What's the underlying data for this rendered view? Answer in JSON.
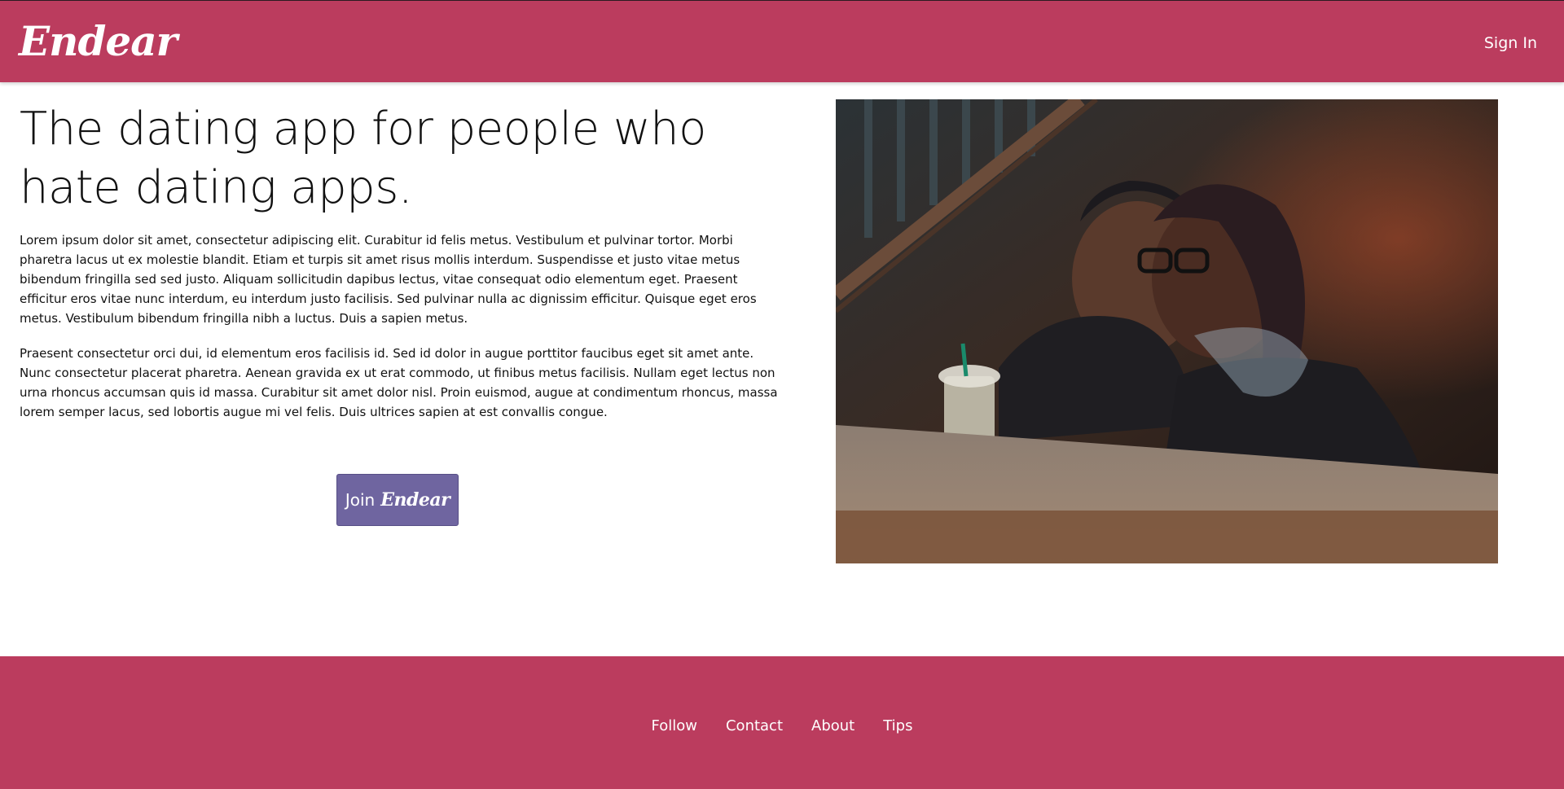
{
  "header": {
    "logo": "Endear",
    "sign_in_label": "Sign In"
  },
  "hero": {
    "headline": "The dating app for people who hate dating apps.",
    "paragraphs": [
      "Lorem ipsum dolor sit amet, consectetur adipiscing elit. Curabitur id felis metus. Vestibulum et pulvinar tortor. Morbi pharetra lacus ut ex molestie blandit. Etiam et turpis sit amet risus mollis interdum. Suspendisse et justo vitae metus bibendum fringilla sed sed justo. Aliquam sollicitudin dapibus lectus, vitae consequat odio elementum eget. Praesent efficitur eros vitae nunc interdum, eu interdum justo facilisis. Sed pulvinar nulla ac dignissim efficitur. Quisque eget eros metus. Vestibulum bibendum fringilla nibh a luctus. Duis a sapien metus.",
      "Praesent consectetur orci dui, id elementum eros facilisis id. Sed id dolor in augue porttitor faucibus eget sit amet ante. Nunc consectetur placerat pharetra. Aenean gravida ex ut erat commodo, ut finibus metus facilisis. Nullam eget lectus non urna rhoncus accumsan quis id massa. Curabitur sit amet dolor nisl. Proin euismod, augue at condimentum rhoncus, massa lorem semper lacus, sed lobortis augue mi vel felis. Duis ultrices sapien at est convallis congue."
    ],
    "join_button": {
      "prefix": "Join",
      "brand": "Endear"
    }
  },
  "footer": {
    "links": [
      "Follow",
      "Contact",
      "About",
      "Tips"
    ]
  },
  "colors": {
    "brand": "#bb3c5e",
    "button": "#6f65a0",
    "text": "#111111",
    "on_brand_text": "#ffffff"
  }
}
